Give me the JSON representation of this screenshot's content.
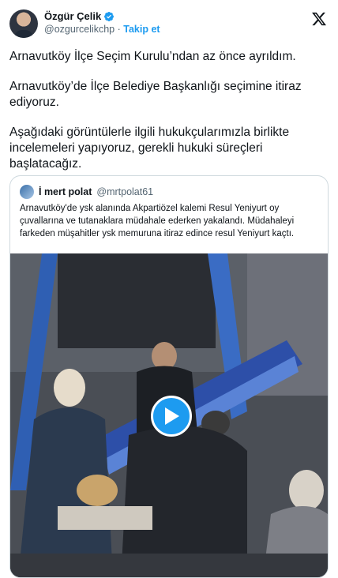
{
  "author": {
    "name": "Özgür Çelik",
    "handle": "@ozgurcelikchp",
    "separator": "·",
    "follow_label": "Takip et",
    "verified": true,
    "avatar_icon": "profile-avatar"
  },
  "platform_icon": "x-logo-icon",
  "tweet": {
    "paragraphs": [
      "Arnavutköy İlçe Seçim Kurulu’ndan az önce ayrıldım.",
      "Arnavutköy’de İlçe Belediye Başkanlığı seçimine itiraz ediyoruz.",
      "Aşağıdaki görüntülerle ilgili hukukçularımızla birlikte incelemeleri yapıyoruz, gerekli hukuki süreçleri başlatacağız."
    ]
  },
  "quoted": {
    "name": "İ mert polat",
    "handle": "@mrtpolat61",
    "text": "Arnavutköy'de ysk alanında Akpartiözel kalemi Resul Yeniyurt oy çuvallarına ve tutanaklara müdahale ederken yakalandı. Müdahaleyi farkeden müşahitler ysk memuruna itiraz edince resul Yeniyurt kaçtı.",
    "media": {
      "type": "video",
      "play_icon": "play-icon"
    }
  },
  "colors": {
    "accent": "#1d9bf0",
    "text": "#0f1419",
    "muted": "#536471",
    "border": "#cfd9de"
  }
}
